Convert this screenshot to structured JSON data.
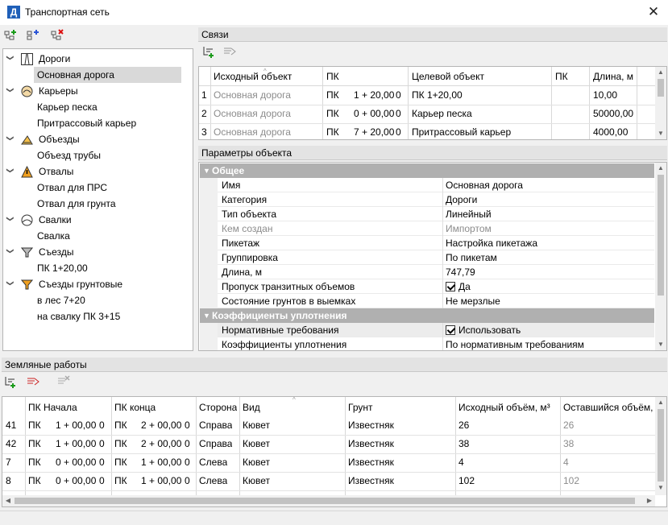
{
  "window": {
    "title": "Транспортная сеть",
    "app_icon_letter": "Д",
    "close": "✕"
  },
  "tree": {
    "groups": [
      {
        "label": "Дороги",
        "icon": "road-icon",
        "items": [
          "Основная дорога"
        ]
      },
      {
        "label": "Карьеры",
        "icon": "quarry-icon",
        "items": [
          "Карьер песка",
          "Притрассовый карьер"
        ]
      },
      {
        "label": "Объезды",
        "icon": "detour-icon",
        "items": [
          "Объезд трубы"
        ]
      },
      {
        "label": "Отвалы",
        "icon": "dump-icon",
        "items": [
          "Отвал для ПРС",
          "Отвал для грунта"
        ]
      },
      {
        "label": "Свалки",
        "icon": "landfill-icon",
        "items": [
          "Свалка"
        ]
      },
      {
        "label": "Съезды",
        "icon": "exit-funnel-icon",
        "items": [
          "ПК 1+20,00"
        ]
      },
      {
        "label": "Съезды грунтовые",
        "icon": "soil-exit-funnel-icon",
        "items": [
          "в лес 7+20",
          "на свалку ПК 3+15"
        ]
      }
    ],
    "selected": "Основная дорога"
  },
  "links": {
    "title": "Связи",
    "columns": [
      "Исходный объект",
      "ПК",
      "Целевой объект",
      "ПК",
      "Длина, м"
    ],
    "rows": [
      {
        "n": "1",
        "src": "Основная дорога",
        "pk_a": "ПК",
        "pk_b": "1 + 20,00",
        "pk_c": "0",
        "target": "ПК 1+20,00",
        "pk2": "",
        "len": "10,00"
      },
      {
        "n": "2",
        "src": "Основная дорога",
        "pk_a": "ПК",
        "pk_b": "0 + 00,00",
        "pk_c": "0",
        "target": "Карьер песка",
        "pk2": "",
        "len": "50000,00"
      },
      {
        "n": "3",
        "src": "Основная дорога",
        "pk_a": "ПК",
        "pk_b": "7 + 20,00",
        "pk_c": "0",
        "target": "Притрассовый карьер",
        "pk2": "",
        "len": "4000,00"
      }
    ]
  },
  "params": {
    "title": "Параметры объекта",
    "group1": "Общее",
    "rows1": [
      {
        "k": "Имя",
        "v": "Основная дорога",
        "gray": false
      },
      {
        "k": "Категория",
        "v": "Дороги",
        "gray": false
      },
      {
        "k": "Тип объекта",
        "v": "Линейный",
        "gray": false
      },
      {
        "k": "Кем создан",
        "v": "Импортом",
        "gray": true
      },
      {
        "k": "Пикетаж",
        "v": "Настройка пикетажа",
        "gray": false
      },
      {
        "k": "Группировка",
        "v": "По пикетам",
        "gray": false
      },
      {
        "k": "Длина, м",
        "v": "747,79",
        "gray": false
      },
      {
        "k": "Пропуск транзитных объемов",
        "v": "Да",
        "gray": false,
        "check": true
      },
      {
        "k": "Состояние грунтов в выемках",
        "v": "Не мерзлые",
        "gray": false
      }
    ],
    "group2": "Коэффициенты уплотнения",
    "rows2": [
      {
        "k": "Нормативные требования",
        "v": "Использовать",
        "check": true
      },
      {
        "k": "Коэффициенты уплотнения",
        "v": "По нормативным требованиям"
      }
    ]
  },
  "earthworks": {
    "title": "Земляные работы",
    "columns": [
      "ПК Начала",
      "ПК конца",
      "Сторона",
      "Вид",
      "Грунт",
      "Исходный объём, м³",
      "Оставшийся объём,"
    ],
    "rows": [
      {
        "n": "41",
        "s_a": "ПК",
        "s_b": "1 + 00,00",
        "s_c": "0",
        "e_a": "ПК",
        "e_b": "2 + 00,00",
        "e_c": "0",
        "side": "Справа",
        "kind": "Кювет",
        "soil": "Известняк",
        "vol": "26",
        "rem": "26"
      },
      {
        "n": "42",
        "s_a": "ПК",
        "s_b": "1 + 00,00",
        "s_c": "0",
        "e_a": "ПК",
        "e_b": "2 + 00,00",
        "e_c": "0",
        "side": "Справа",
        "kind": "Кювет",
        "soil": "Известняк",
        "vol": "38",
        "rem": "38"
      },
      {
        "n": "7",
        "s_a": "ПК",
        "s_b": "0 + 00,00",
        "s_c": "0",
        "e_a": "ПК",
        "e_b": "1 + 00,00",
        "e_c": "0",
        "side": "Слева",
        "kind": "Кювет",
        "soil": "Известняк",
        "vol": "4",
        "rem": "4"
      },
      {
        "n": "8",
        "s_a": "ПК",
        "s_b": "0 + 00,00",
        "s_c": "0",
        "e_a": "ПК",
        "e_b": "1 + 00,00",
        "e_c": "0",
        "side": "Слева",
        "kind": "Кювет",
        "soil": "Известняк",
        "vol": "102",
        "rem": "102"
      }
    ]
  },
  "colors": {
    "accent": "#1f5fb8",
    "group_header": "#b0b0b0",
    "selected": "#d9d9d9"
  }
}
